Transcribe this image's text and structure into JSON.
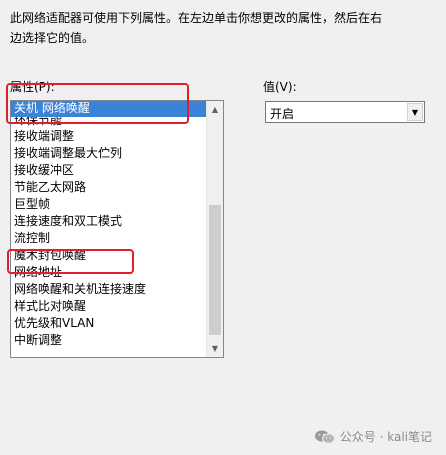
{
  "description": {
    "line1": "此网络适配器可使用下列属性。在左边单击你想更改的属性，然后在右",
    "line2": "边选择它的值。"
  },
  "property_label": "属性(P):",
  "value_label": "值(V):",
  "properties": [
    {
      "label": "关机 网络唤醒",
      "selected": true
    },
    {
      "label": "环保节能",
      "cut": true
    },
    {
      "label": "接收端调整"
    },
    {
      "label": "接收端调整最大伫列"
    },
    {
      "label": "接收缓冲区"
    },
    {
      "label": "节能乙太网路"
    },
    {
      "label": "巨型帧"
    },
    {
      "label": "连接速度和双工模式"
    },
    {
      "label": "流控制"
    },
    {
      "label": "魔术封包唤醒"
    },
    {
      "label": "网络地址"
    },
    {
      "label": "网络唤醒和关机连接速度"
    },
    {
      "label": "样式比对唤醒"
    },
    {
      "label": "优先级和VLAN"
    },
    {
      "label": "中断调整"
    }
  ],
  "value_selected": "开启",
  "scroll": {
    "up_arrow": "▲",
    "down_arrow": "▼"
  },
  "dropdown_arrow": "▼",
  "watermark": {
    "text": "公众号 · kali笔记",
    "icon": "wechat-icon"
  },
  "colors": {
    "selection": "#3b83d9",
    "highlight_box": "#e0202e",
    "background": "#f0f0f0"
  }
}
